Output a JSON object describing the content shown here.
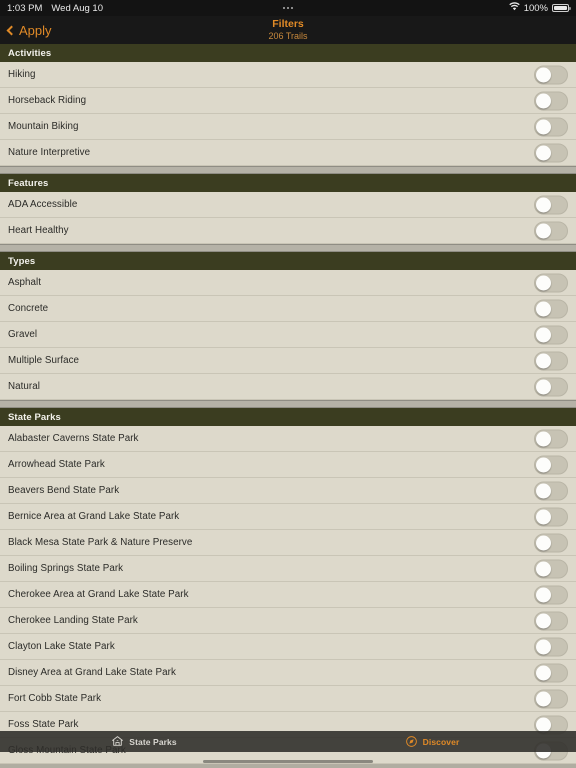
{
  "status_bar": {
    "time": "1:03 PM",
    "date": "Wed Aug 10",
    "center_indicator": "more-dots",
    "battery_percent": "100%",
    "wifi_icon": "wifi-icon",
    "battery_icon": "battery-full-icon"
  },
  "nav_bar": {
    "back_label": "Apply",
    "back_icon": "chevron-left-icon",
    "title": "Filters",
    "subtitle": "206 Trails"
  },
  "colors": {
    "accent": "#e08a27",
    "section_header_bg": "#3b3d20",
    "row_bg": "#ddd9cb",
    "page_bg": "#d7d3c4",
    "status_bar_bg": "#131313"
  },
  "sections": [
    {
      "title": "Activities",
      "gap_before": false,
      "rows": [
        {
          "label": "Hiking",
          "on": false
        },
        {
          "label": "Horseback Riding",
          "on": false
        },
        {
          "label": "Mountain Biking",
          "on": false
        },
        {
          "label": "Nature Interpretive",
          "on": false
        }
      ]
    },
    {
      "title": "Features",
      "gap_before": true,
      "rows": [
        {
          "label": "ADA Accessible",
          "on": false
        },
        {
          "label": "Heart Healthy",
          "on": false
        }
      ]
    },
    {
      "title": "Types",
      "gap_before": true,
      "rows": [
        {
          "label": "Asphalt",
          "on": false
        },
        {
          "label": "Concrete",
          "on": false
        },
        {
          "label": "Gravel",
          "on": false
        },
        {
          "label": "Multiple Surface",
          "on": false
        },
        {
          "label": "Natural",
          "on": false
        }
      ]
    },
    {
      "title": "State Parks",
      "gap_before": true,
      "rows": [
        {
          "label": "Alabaster Caverns State Park",
          "on": false
        },
        {
          "label": "Arrowhead State Park",
          "on": false
        },
        {
          "label": "Beavers Bend State Park",
          "on": false
        },
        {
          "label": "Bernice Area at Grand Lake State Park",
          "on": false
        },
        {
          "label": "Black Mesa State Park & Nature Preserve",
          "on": false
        },
        {
          "label": "Boiling Springs State Park",
          "on": false
        },
        {
          "label": "Cherokee Area at Grand Lake State Park",
          "on": false
        },
        {
          "label": "Cherokee Landing State Park",
          "on": false
        },
        {
          "label": "Clayton Lake State Park",
          "on": false
        },
        {
          "label": "Disney Area at Grand Lake State Park",
          "on": false
        },
        {
          "label": "Fort Cobb State Park",
          "on": false
        },
        {
          "label": "Foss State Park",
          "on": false
        },
        {
          "label": "Gloss Mountain State Park",
          "on": false
        }
      ]
    }
  ],
  "tab_bar": {
    "tabs": [
      {
        "label": "State Parks",
        "icon": "park-building-icon",
        "active": false
      },
      {
        "label": "Discover",
        "icon": "compass-icon",
        "active": true
      }
    ]
  }
}
